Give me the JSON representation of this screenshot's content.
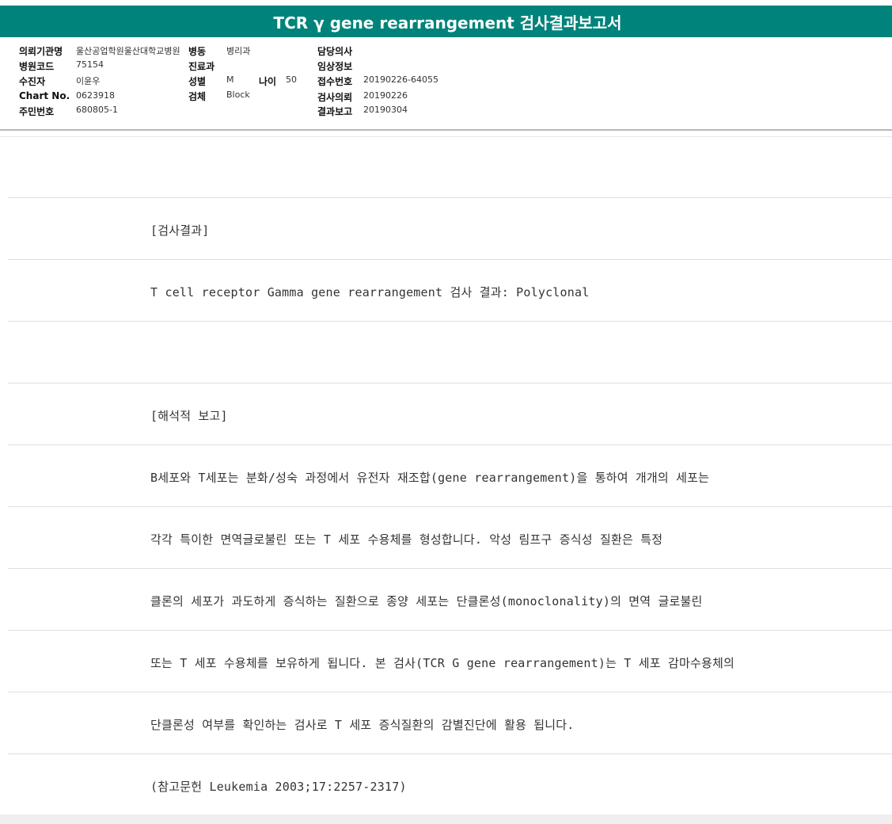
{
  "report": {
    "title": "TCR γ gene rearrangement 검사결과보고서",
    "header": {
      "institution_label": "의뢰기관명",
      "institution_value": "울산공업학원울산대학교병원",
      "ward_label": "병동",
      "ward_value": "병리과",
      "physician_label": "담당의사",
      "hospital_code_label": "병원코드",
      "hospital_code_value": "75154",
      "department_label": "진료과",
      "clinical_info_label": "임상정보",
      "patient_label": "수진자",
      "patient_value": "이윤우",
      "sex_label": "성별",
      "sex_value": "M",
      "age_label": "나이",
      "age_value": "50",
      "receipt_label": "접수번호",
      "receipt_value": "20190226-64055",
      "chart_label": "Chart No.",
      "chart_value": "0623918",
      "specimen_label": "검체",
      "specimen_value": "Block",
      "request_date_label": "검사의뢰",
      "request_date_value": "20190226",
      "resident_label": "주민번호",
      "resident_value": "680805-1",
      "report_date_label": "결과보고",
      "report_date_value": "20190304"
    },
    "lines": [
      "",
      "[검사결과]",
      "T cell receptor Gamma gene rearrangement 검사 결과: Polyclonal",
      "",
      "[해석적 보고]",
      "B세포와 T세포는 분화/성숙 과정에서 유전자 재조합(gene rearrangement)을 통하여 개개의 세포는",
      "각각 특이한 면역글로불린 또는 T 세포 수용체를 형성합니다. 악성 림프구 증식성 질환은 특정",
      "클론의 세포가 과도하게 증식하는 질환으로 종양 세포는 단클론성(monoclonality)의 면역 글로불린",
      "또는 T 세포 수용체를 보유하게 됩니다. 본 검사(TCR G gene rearrangement)는 T 세포 감마수용체의",
      "단클론성 여부를 확인하는 검사로 T 세포 증식질환의 감별진단에 활용 됩니다.",
      "(참고문헌 Leukemia 2003;17:2257-2317)"
    ]
  }
}
